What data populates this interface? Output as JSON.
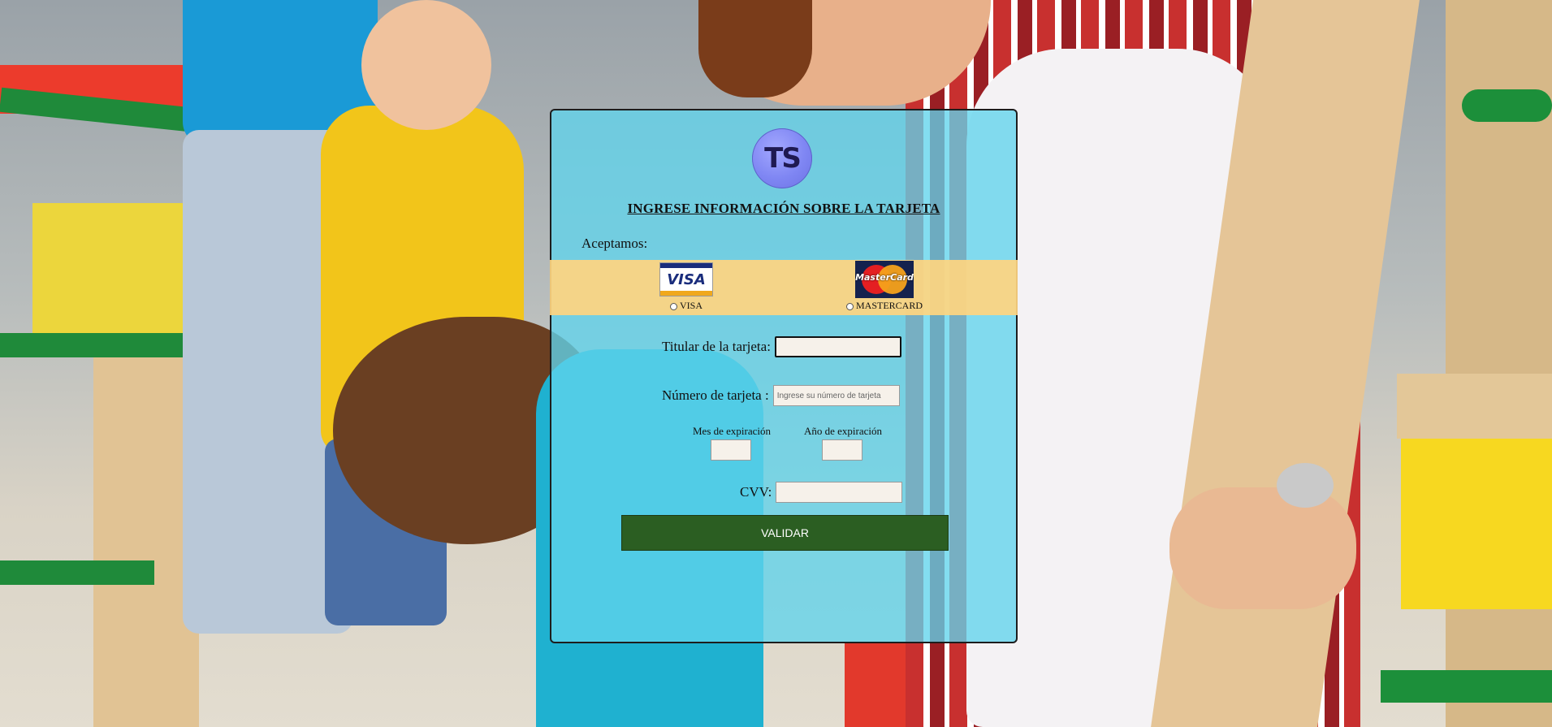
{
  "logo_text": "TS",
  "title": "INGRESE INFORMACIÓN SOBRE LA TARJETA",
  "accept_label": "Aceptamos:",
  "cards": [
    {
      "label": "VISA",
      "logo_text": "VISA",
      "selected": false
    },
    {
      "label": "MASTERCARD",
      "logo_text": "MasterCard",
      "selected": false
    }
  ],
  "fields": {
    "holder_label": "Titular de la tarjeta:",
    "number_label": "Número de tarjeta :",
    "number_placeholder": "Ingrese su número de tarjeta",
    "month_label": "Mes de expiración",
    "year_label": "Año de expiración",
    "cvv_label": "CVV:"
  },
  "validate_label": "VALIDAR",
  "colors": {
    "card_bg": "#60d4ec",
    "strip_bg": "#ffd580",
    "button_bg": "#2b5e22",
    "logo_bg": "#7f86f3"
  }
}
